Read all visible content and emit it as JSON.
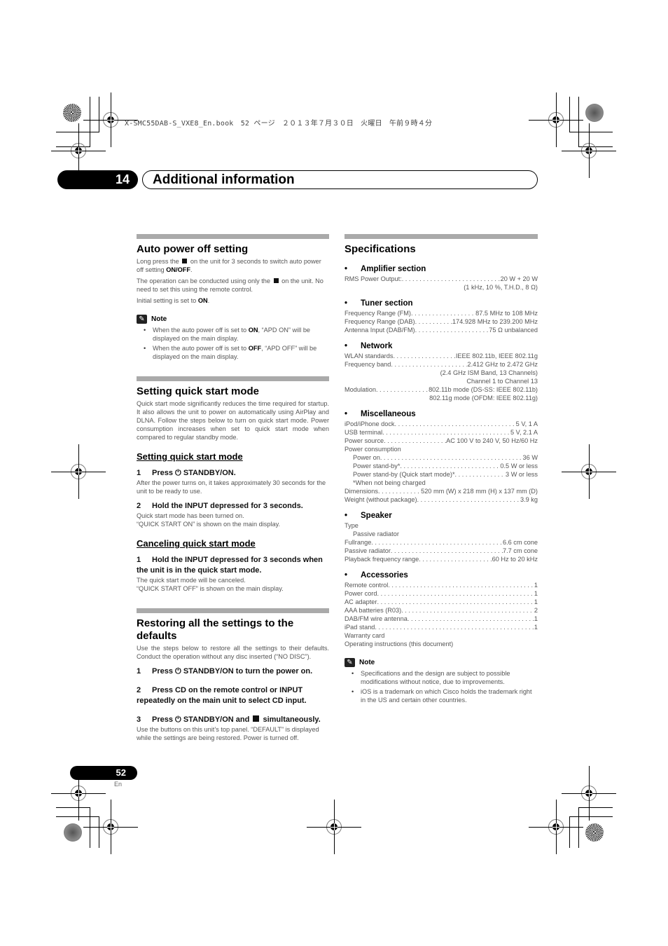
{
  "print_header": "X-SMC55DAB-S_VXE8_En.book　52 ページ　２０１３年７月３０日　火曜日　午前９時４分",
  "chapter": {
    "number": "14",
    "title": "Additional information"
  },
  "left": {
    "auto_power_off": {
      "title": "Auto power off setting",
      "p1_a": "Long press the",
      "p1_b": "on the unit for 3 seconds to switch auto power off setting",
      "p1_on": "ON",
      "p1_slash": "/",
      "p1_off": "OFF",
      "p1_end": ".",
      "p2_a": "The operation can be conducted using only the",
      "p2_b": "on the unit. No need to set this using the remote control.",
      "p3_a": "Initial setting is set to",
      "p3_on": "ON",
      "p3_end": ".",
      "note_label": "Note",
      "notes": [
        {
          "a": "When the auto power off is set to",
          "k": "ON",
          "b": ", “APD ON” will be displayed on the main display."
        },
        {
          "a": "When the auto power off is set to",
          "k": "OFF",
          "b": ", “APD OFF” will be displayed on the main display."
        }
      ]
    },
    "quick_start": {
      "title": "Setting quick start mode",
      "intro": "Quick start mode significantly reduces the time required for startup. It also allows the unit to power on automatically using AirPlay and DLNA. Follow the steps below to turn on quick start mode. Power consumption increases when set to quick start mode when compared to regular standby mode.",
      "sub1_title": "Setting quick start mode",
      "sub1_steps": [
        {
          "n": "1",
          "a": "Press",
          "icon": "⏻",
          "b": "STANDBY/ON.",
          "desc": "After the power turns on, it takes approximately 30 seconds for the unit to be ready to use."
        },
        {
          "n": "2",
          "a": "Hold the INPUT depressed for 3 seconds.",
          "desc1": "Quick start mode has been turned on.",
          "desc2": "“QUICK START ON” is shown on the main display."
        }
      ],
      "sub2_title": "Canceling quick start mode",
      "sub2_step": {
        "n": "1",
        "a": "Hold the INPUT depressed for 3 seconds when the unit is in the quick start mode.",
        "desc1": "The quick start mode will be canceled.",
        "desc2": "“QUICK START OFF” is shown on the main display."
      }
    },
    "restore": {
      "title": "Restoring all the settings to the defaults",
      "intro": "Use the steps below to restore all the settings to their defaults. Conduct the operation without any disc inserted (“NO DISC”).",
      "step1": {
        "n": "1",
        "a": "Press",
        "icon": "⏻",
        "b": "STANDBY/ON to turn the power on."
      },
      "step2": {
        "n": "2",
        "a": "Press CD on the remote control or INPUT repeatedly on the main unit to select CD input."
      },
      "step3": {
        "n": "3",
        "a": "Press",
        "icon": "⏻",
        "b": "STANDBY/ON and",
        "c": "simultaneously.",
        "desc": "Use the buttons on this unit’s top panel. “DEFAULT” is displayed while the settings are being restored. Power is turned off."
      }
    }
  },
  "right": {
    "title": "Specifications",
    "amplifier": {
      "head": "Amplifier section",
      "rows": [
        {
          "label": "RMS Power Output:",
          "value": "20 W + 20 W"
        }
      ],
      "extra": "(1 kHz, 10 %, T.H.D., 8 Ω)"
    },
    "tuner": {
      "head": "Tuner section",
      "rows": [
        {
          "label": "Frequency Range (FM)",
          "value": "87.5 MHz to 108 MHz"
        },
        {
          "label": "Frequency Range (DAB)",
          "value": "174.928 MHz to 239.200 MHz"
        },
        {
          "label": "Antenna Input (DAB/FM)",
          "value": "75 Ω unbalanced"
        }
      ]
    },
    "network": {
      "head": "Network",
      "wlan": {
        "label": "WLAN standards",
        "value": "IEEE 802.11b, IEEE 802.11g"
      },
      "freq": {
        "label": "Frequency band",
        "value": "2.412 GHz to 2.472 GHz"
      },
      "freq_extra1": "(2.4 GHz ISM Band, 13 Channels)",
      "freq_extra2": "Channel 1 to Channel 13",
      "mod": {
        "label": "Modulation",
        "value": "802.11b mode (DS-SS: IEEE 802.11b)"
      },
      "mod_extra": "802.11g mode (OFDM: IEEE 802.11g)"
    },
    "misc": {
      "head": "Miscellaneous",
      "dock": {
        "label": "iPod/iPhone dock",
        "value": "5 V, 1 A"
      },
      "usb": {
        "label": "USB terminal",
        "value": "5 V, 2.1 A"
      },
      "source": {
        "label": "Power source",
        "value": "AC 100 V to 240 V, 50 Hz/60 Hz"
      },
      "consumption_label": "Power consumption",
      "power_on": {
        "label": "Power on",
        "value": "36 W"
      },
      "standby": {
        "label": "Power stand-by*",
        "value": "0.5 W or less"
      },
      "standby_qs": {
        "label": "Power stand-by (Quick start mode)*",
        "value": "3 W or less"
      },
      "footnote": "*When not being charged",
      "dimensions": {
        "label": "Dimensions",
        "value": "520 mm (W) x 218 mm (H) x 137 mm (D)"
      },
      "weight": {
        "label": "Weight (without package)",
        "value": "3.9 kg"
      }
    },
    "speaker": {
      "head": "Speaker",
      "type_label": "Type",
      "type_value": "Passive radiator",
      "rows": [
        {
          "label": "Fullrange",
          "value": "6.6 cm cone"
        },
        {
          "label": "Passive radiator",
          "value": "7.7 cm cone"
        },
        {
          "label": "Playback frequency range",
          "value": "60 Hz to 20 kHz"
        }
      ]
    },
    "accessories": {
      "head": "Accessories",
      "rows": [
        {
          "label": "Remote control",
          "value": "1"
        },
        {
          "label": "Power cord",
          "value": "1"
        },
        {
          "label": "AC adapter",
          "value": "1"
        },
        {
          "label": "AAA batteries (R03)",
          "value": "2"
        },
        {
          "label": "DAB/FM wire antenna",
          "value": "1"
        },
        {
          "label": "iPad stand",
          "value": "1"
        }
      ],
      "plain": [
        "Warranty card",
        "Operating instructions (this document)"
      ]
    },
    "note_label": "Note",
    "notes": [
      "Specifications and the design are subject to possible modifications without notice, due to improvements.",
      "iOS is a trademark on which Cisco holds the trademark right in the US and certain other countries."
    ]
  },
  "footer": {
    "page": "52",
    "lang": "En"
  }
}
